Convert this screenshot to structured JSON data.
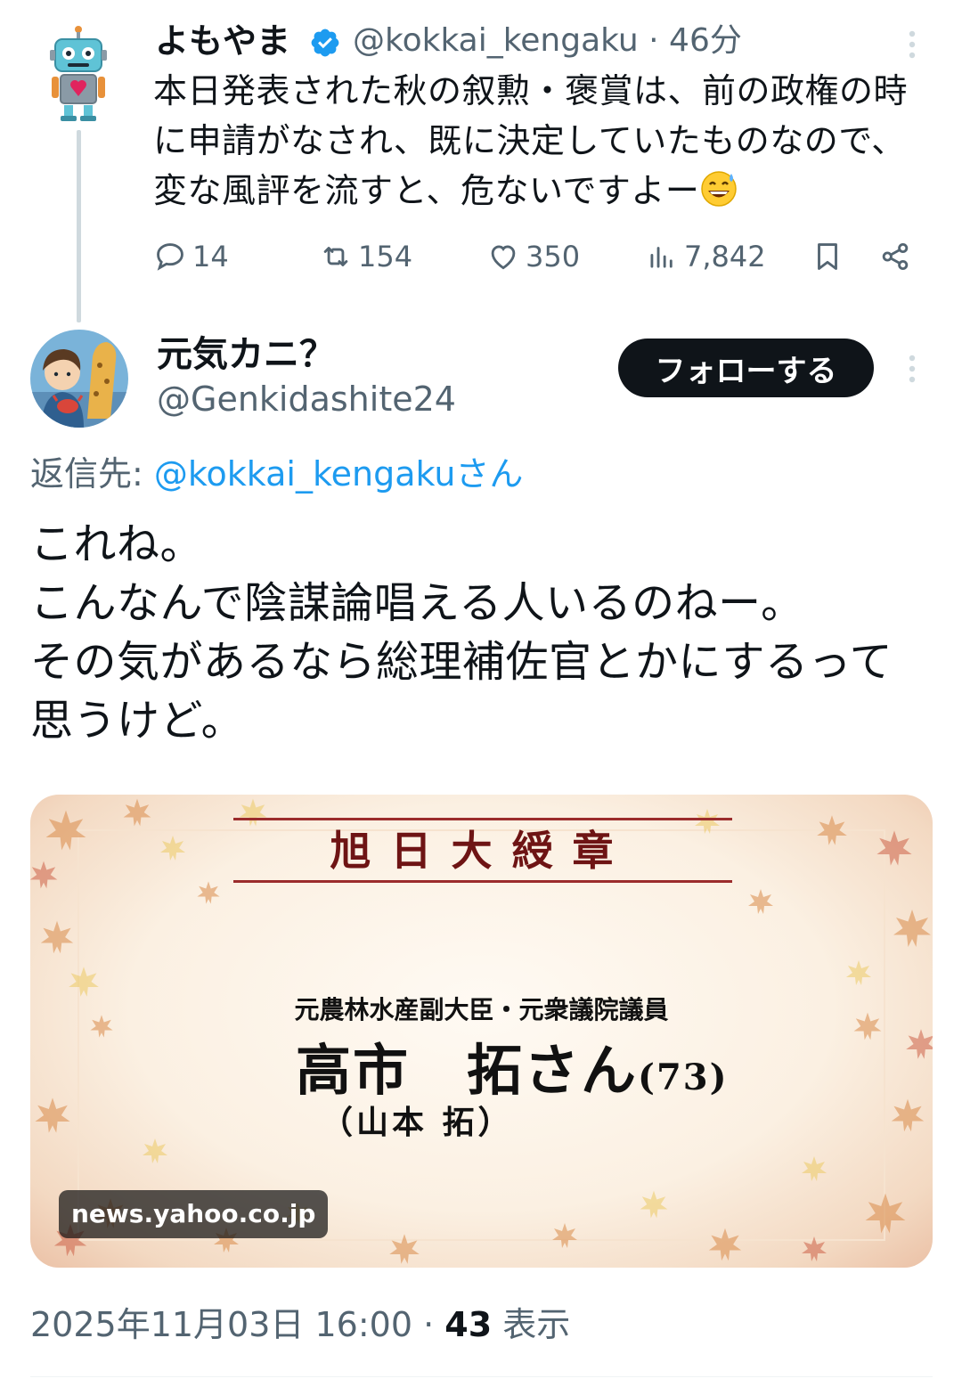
{
  "parent_tweet": {
    "display_name": "よもやま",
    "handle": "@kokkai_kengaku",
    "time": "· 46分",
    "text": "本日発表された秋の叙勲・褒賞は、前の政権の時に申請がなされ、既に決定していたものなので、変な風評を流すと、危ないですよー",
    "emoji": "grinning-sweat-emoji",
    "stats": {
      "replies": "14",
      "retweets": "154",
      "likes": "350",
      "views": "7,842"
    }
  },
  "reply_tweet": {
    "display_name": "元気カニ？",
    "handle": "@Genkidashite24",
    "follow_label": "フォローする",
    "replying_prefix": "返信先: ",
    "replying_mention": "@kokkai_kengakuさん",
    "text_lines": [
      "これね。",
      "こんなんで陰謀論唱える人いるのねー。",
      "その気があるなら総理補佐官とかにするって",
      "思うけど。"
    ],
    "card": {
      "award": "旭日大綬章",
      "subtitle": "元農林水産副大臣・元衆議院議員",
      "name": "高市　拓さん",
      "age": "(73)",
      "real_name": "（山本 拓）",
      "domain": "news.yahoo.co.jp"
    },
    "timestamp": "2025年11月03日 16:00 · ",
    "views_count": "43",
    "views_label": " 表示"
  },
  "colors": {
    "text": "#0f1419",
    "secondary": "#536471",
    "link": "#1d9bf0",
    "verified": "#1d9bf0",
    "follow_bg": "#0f1419"
  }
}
